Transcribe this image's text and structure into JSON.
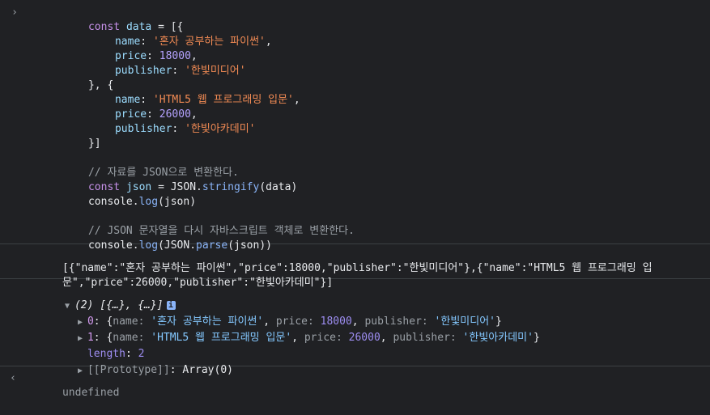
{
  "input": {
    "prompt_icon": "chevron-right-icon",
    "lines": {
      "l1": {
        "kw": "const",
        "var": "data",
        "rest": " = [{"
      },
      "l2": {
        "prop": "name",
        "sep": ": ",
        "str": "'혼자 공부하는 파이썬'",
        "end": ","
      },
      "l3": {
        "prop": "price",
        "sep": ": ",
        "num": "18000",
        "end": ","
      },
      "l4": {
        "prop": "publisher",
        "sep": ": ",
        "str": "'한빛미디어'"
      },
      "l5": {
        "text": "}, {"
      },
      "l6": {
        "prop": "name",
        "sep": ": ",
        "str": "'HTML5 웹 프로그래밍 입문'",
        "end": ","
      },
      "l7": {
        "prop": "price",
        "sep": ": ",
        "num": "26000",
        "end": ","
      },
      "l8": {
        "prop": "publisher",
        "sep": ": ",
        "str": "'한빛아카데미'"
      },
      "l9": {
        "text": "}]"
      },
      "l11": {
        "comment": "// 자료를 JSON으로 변환한다."
      },
      "l12": {
        "kw": "const",
        "var": "json",
        "mid": " = JSON.",
        "fn": "stringify",
        "rest": "(data)"
      },
      "l13": {
        "obj": "console.",
        "fn": "log",
        "rest": "(json)"
      },
      "l15": {
        "comment": "// JSON 문자열을 다시 자바스크립트 객체로 변환한다."
      },
      "l16": {
        "obj": "console.",
        "fn": "log",
        "mid": "(JSON.",
        "fn2": "parse",
        "rest": "(json))"
      }
    }
  },
  "output_json": {
    "line1": "[{\"name\":\"혼자 공부하는 파이썬\",\"price\":18000,\"publisher\":\"한빛미디어\"},{\"name\":\"HTML5 웹 프로그래밍 입",
    "line2": "문\",\"price\":26000,\"publisher\":\"한빛아카데미\"}]"
  },
  "output_array": {
    "summary": "(2) [{…}, {…}]",
    "badge": "i",
    "items": [
      {
        "index": "0",
        "name": "'혼자 공부하는 파이썬'",
        "price": "18000",
        "publisher": "'한빛미디어'"
      },
      {
        "index": "1",
        "name": "'HTML5 웹 프로그래밍 입문'",
        "price": "26000",
        "publisher": "'한빛아카데미'"
      }
    ],
    "length_label": "length",
    "length_value": "2",
    "prototype_label": "[[Prototype]]",
    "prototype_value": "Array(0)"
  },
  "result": {
    "icon": "return-arrow-icon",
    "text": "undefined"
  }
}
